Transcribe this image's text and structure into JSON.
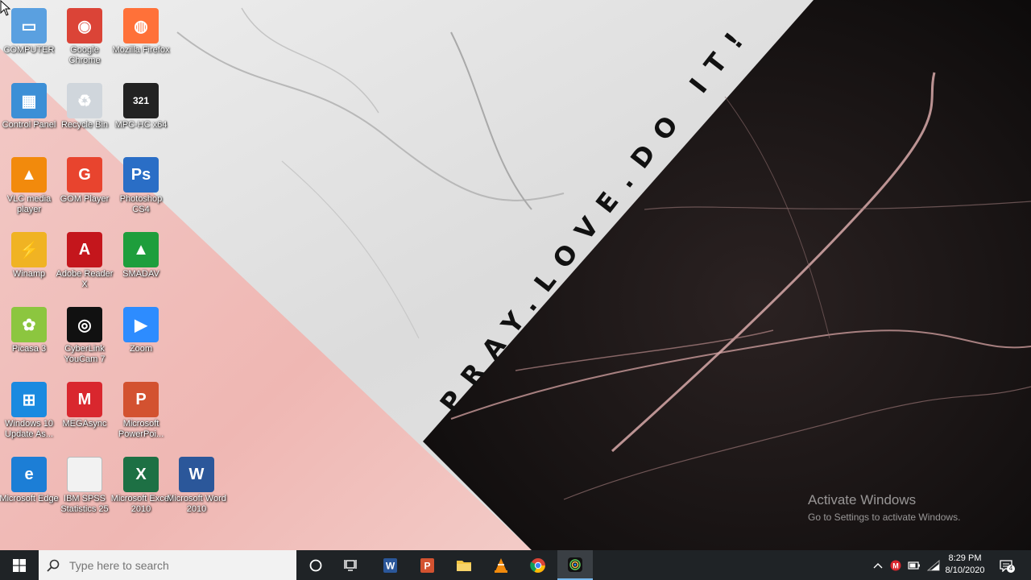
{
  "wallpaper": {
    "motto": "PRAY.LOVE.DO IT!",
    "watermark_title": "Activate Windows",
    "watermark_subtitle": "Go to Settings to activate Windows."
  },
  "desktop_icons": [
    {
      "label": "COMPUTER",
      "icon": "computer-icon",
      "color": "#5aa0e0"
    },
    {
      "label": "Google Chrome",
      "icon": "chrome-icon",
      "color": "#db4437"
    },
    {
      "label": "Mozilla Firefox",
      "icon": "firefox-icon",
      "color": "#ff7139"
    },
    {
      "label": "Control Panel",
      "icon": "control-panel-icon",
      "color": "#3c8fd6"
    },
    {
      "label": "Recycle Bin",
      "icon": "recycle-bin-icon",
      "color": "#d0d6dc"
    },
    {
      "label": "MPC-HC x64",
      "icon": "mpc-hc-icon",
      "color": "#222222"
    },
    {
      "label": "VLC media player",
      "icon": "vlc-icon",
      "color": "#f28a0c"
    },
    {
      "label": "GOM Player",
      "icon": "gom-player-icon",
      "color": "#e8442e"
    },
    {
      "label": "Photoshop CS4",
      "icon": "photoshop-icon",
      "color": "#2a6ec6"
    },
    {
      "label": "Winamp",
      "icon": "winamp-icon",
      "color": "#f0b323"
    },
    {
      "label": "Adobe Reader X",
      "icon": "adobe-reader-icon",
      "color": "#c4161c"
    },
    {
      "label": "SMADAV",
      "icon": "smadav-icon",
      "color": "#1e9e3c"
    },
    {
      "label": "Picasa 3",
      "icon": "picasa-icon",
      "color": "#8cc63f"
    },
    {
      "label": "CyberLink YouCam 7",
      "icon": "youcam-icon",
      "color": "#111111"
    },
    {
      "label": "Zoom",
      "icon": "zoom-icon",
      "color": "#2d8cff"
    },
    {
      "label": "Windows 10 Update As...",
      "icon": "windows-update-icon",
      "color": "#1a8ae0"
    },
    {
      "label": "MEGAsync",
      "icon": "megasync-icon",
      "color": "#d9272e"
    },
    {
      "label": "Microsoft PowerPoi...",
      "icon": "powerpoint-icon",
      "color": "#d35230"
    },
    {
      "label": "Microsoft Edge",
      "icon": "edge-icon",
      "color": "#1c7ed6"
    },
    {
      "label": "IBM SPSS Statistics 25",
      "icon": "spss-file-icon",
      "color": "#f2f2f2"
    },
    {
      "label": "Microsoft Excel 2010",
      "icon": "excel-icon",
      "color": "#1d7044"
    },
    {
      "label": "Microsoft Word 2010",
      "icon": "word-icon",
      "color": "#2b579a"
    }
  ],
  "taskbar": {
    "search_placeholder": "Type here to search",
    "apps": [
      {
        "name": "cortana-button",
        "icon": "cortana-icon"
      },
      {
        "name": "task-view-button",
        "icon": "task-view-icon"
      },
      {
        "name": "word-taskbar-button",
        "icon": "word-icon",
        "color": "#2b579a"
      },
      {
        "name": "powerpoint-taskbar-button",
        "icon": "powerpoint-icon",
        "color": "#d35230"
      },
      {
        "name": "file-explorer-taskbar-button",
        "icon": "folder-icon",
        "color": "#f4c542"
      },
      {
        "name": "vlc-taskbar-button",
        "icon": "vlc-icon",
        "color": "#f28a0c"
      },
      {
        "name": "chrome-taskbar-button",
        "icon": "chrome-icon",
        "color": "#db4437"
      },
      {
        "name": "youcam-taskbar-button",
        "icon": "youcam-icon",
        "color": "#111111"
      }
    ],
    "clock_time": "8:29 PM",
    "clock_date": "8/10/2020"
  }
}
